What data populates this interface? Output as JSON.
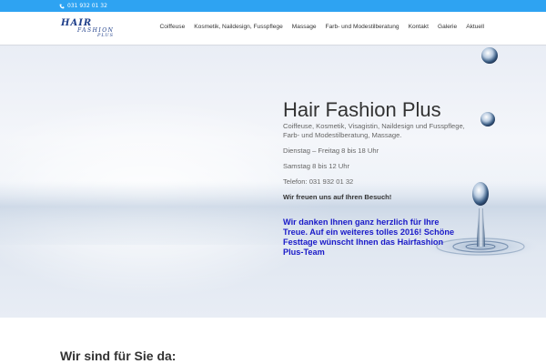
{
  "topbar": {
    "phone": "031 932 01 32",
    "phone_icon": "phone-icon",
    "color": "#2ea3f2"
  },
  "logo": {
    "line1": "HAIR",
    "line2": "FASHION",
    "line3": "PLUS",
    "color": "#1f3f8a"
  },
  "nav": {
    "items": [
      {
        "label": "Coiffeuse"
      },
      {
        "label": "Kosmetik, Naildesign, Fusspflege"
      },
      {
        "label": "Massage"
      },
      {
        "label": "Farb- und Modestilberatung"
      },
      {
        "label": "Kontakt"
      },
      {
        "label": "Galerie"
      },
      {
        "label": "Aktuell"
      }
    ]
  },
  "hero": {
    "title": "Hair Fashion Plus",
    "subtitle": "Coiffeuse, Kosmetik, Visagistin, Naildesign und Fusspflege, Farb- und Modestilberatung, Massage.",
    "hours_weekday": "Dienstag – Freitag 8 bis 18 Uhr",
    "hours_saturday": "Samstag 8 bis 12 Uhr",
    "phone": "Telefon: 031 932 01 32",
    "welcome": "Wir freuen uns auf Ihren Besuch!",
    "holiday_message": "Wir danken Ihnen ganz herzlich für Ihre Treue. Auf ein weiteres tolles 2016! Schöne Festtage wünscht Ihnen das Hairfashion Plus-Team",
    "holiday_color": "#1a1ac8"
  },
  "section": {
    "title": "Wir sind für Sie da:"
  }
}
